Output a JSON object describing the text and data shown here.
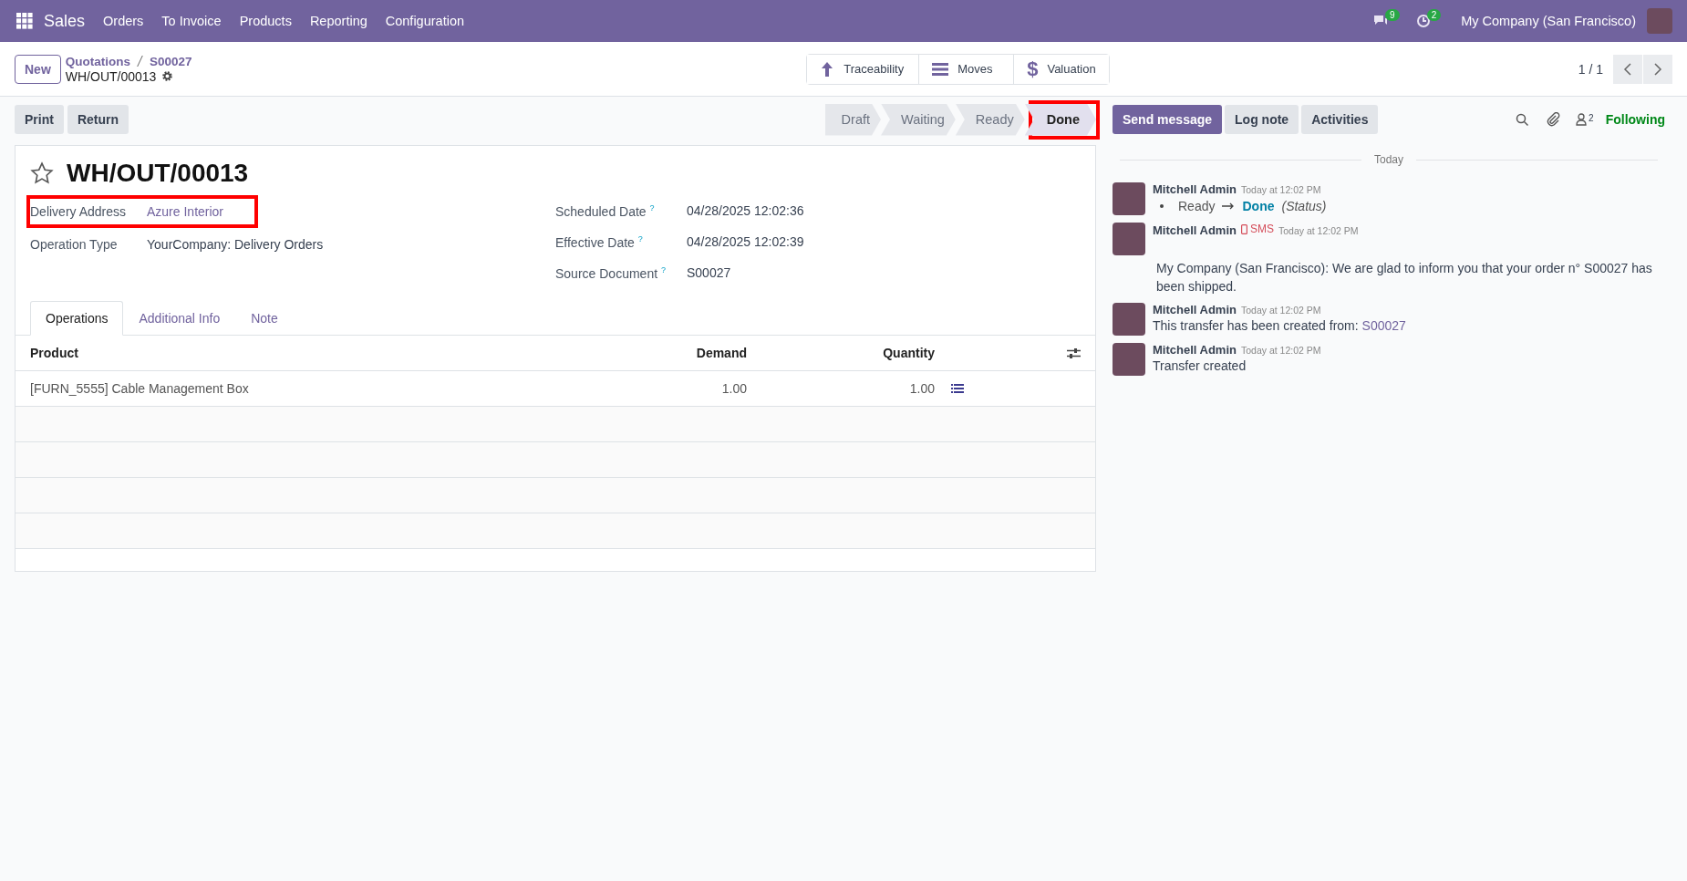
{
  "navbar": {
    "app": "Sales",
    "menu": [
      "Orders",
      "To Invoice",
      "Products",
      "Reporting",
      "Configuration"
    ],
    "messages_count": "9",
    "activities_count": "2",
    "company": "My Company (San Francisco)"
  },
  "control_panel": {
    "new_button": "New",
    "breadcrumbs": [
      "Quotations",
      "S00027"
    ],
    "record": "WH/OUT/00013",
    "smart_buttons": [
      {
        "kind": "arrow",
        "label": "Traceability"
      },
      {
        "kind": "list",
        "label": "Moves"
      },
      {
        "kind": "dollar",
        "icon": "$",
        "label": "Valuation"
      }
    ],
    "pager": "1 / 1"
  },
  "actions": [
    "Print",
    "Return"
  ],
  "stages": [
    {
      "label": "Draft",
      "selected": false,
      "highlighted": false
    },
    {
      "label": "Waiting",
      "selected": false,
      "highlighted": false
    },
    {
      "label": "Ready",
      "selected": false,
      "highlighted": false
    },
    {
      "label": "Done",
      "selected": true,
      "highlighted": true
    }
  ],
  "form": {
    "title": "WH/OUT/00013",
    "starred": false,
    "left_fields": [
      {
        "label": "Delivery Address",
        "value": "Azure Interior",
        "link": true,
        "highlighted": true
      },
      {
        "label": "Operation Type",
        "value": "YourCompany: Delivery Orders",
        "link": false,
        "highlighted": false
      }
    ],
    "right_fields": [
      {
        "label": "Scheduled Date",
        "help": "?",
        "value": "04/28/2025 12:02:36"
      },
      {
        "label": "Effective Date",
        "help": "?",
        "value": "04/28/2025 12:02:39"
      },
      {
        "label": "Source Document",
        "help": "?",
        "value": "S00027"
      }
    ],
    "tabs": [
      {
        "label": "Operations",
        "selected": true
      },
      {
        "label": "Additional Info",
        "selected": false
      },
      {
        "label": "Note",
        "selected": false
      }
    ],
    "table": {
      "columns": [
        "Product",
        "Demand",
        "Quantity"
      ],
      "rows": [
        {
          "product": "[FURN_5555] Cable Management Box",
          "demand": "1.00",
          "quantity": "1.00"
        }
      ]
    }
  },
  "chatter": {
    "buttons": [
      {
        "label": "Send message",
        "selected": true
      },
      {
        "label": "Log note",
        "selected": false
      },
      {
        "label": "Activities",
        "selected": false
      }
    ],
    "followers_count": "2",
    "following": "Following",
    "date_separator": "Today",
    "messages": [
      {
        "kind": "tracking",
        "author": "Mitchell Admin",
        "time": "Today at 12:02 PM",
        "old": "Ready",
        "new": "Done",
        "field": "(Status)"
      },
      {
        "kind": "sms",
        "author": "Mitchell Admin",
        "badge": "SMS",
        "time": "Today at 12:02 PM",
        "body": "My Company (San Francisco): We are glad to inform you that your order n° S00027 has been shipped."
      },
      {
        "kind": "link",
        "author": "Mitchell Admin",
        "time": "Today at 12:02 PM",
        "body": "This transfer has been created from:",
        "link": "S00027"
      },
      {
        "kind": "text",
        "author": "Mitchell Admin",
        "time": "Today at 12:02 PM",
        "body": "Transfer created"
      }
    ]
  }
}
